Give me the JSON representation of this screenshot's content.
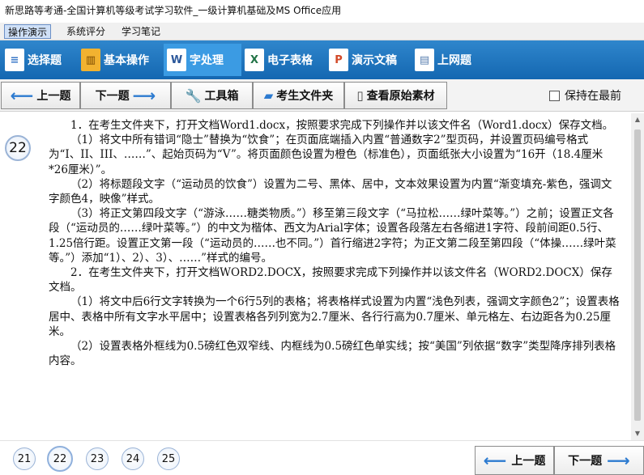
{
  "window": {
    "title": "新思路等考通-全国计算机等级考试学习软件_一级计算机基础及MS Office应用"
  },
  "menu": {
    "items": [
      "操作演示",
      "系统评分",
      "学习笔记"
    ]
  },
  "categories": [
    {
      "label": "选择题",
      "icon": "list-icon",
      "color": "#3a78c8"
    },
    {
      "label": "基本操作",
      "icon": "books-icon",
      "color": "#e0a020"
    },
    {
      "label": "字处理",
      "icon": "word-icon",
      "color": "#2b579a"
    },
    {
      "label": "电子表格",
      "icon": "excel-icon",
      "color": "#217346"
    },
    {
      "label": "演示文稿",
      "icon": "powerpoint-icon",
      "color": "#d24726"
    },
    {
      "label": "上网题",
      "icon": "document-icon",
      "color": "#5a7fb0"
    }
  ],
  "toolbar": {
    "prev": "上一题",
    "next": "下一题",
    "tools": "工具箱",
    "folder": "考生文件夹",
    "view": "查看原始素材",
    "keep_front": "保持在最前"
  },
  "question": {
    "number": "22",
    "paragraphs": [
      "1．在考生文件夹下，打开文档Word1.docx，按照要求完成下列操作并以该文件名（Word1.docx）保存文档。",
      "（1）将文中所有错词“隐士”替换为“饮食”；在页面底端插入内置“普通数字2”型页码，并设置页码编号格式为“I、II、III、……”、起始页码为“V”。将页面颜色设置为橙色（标准色），页面纸张大小设置为“16开（18.4厘米*26厘米）”。",
      "（2）将标题段文字（“运动员的饮食”）设置为二号、黑体、居中，文本效果设置为内置“渐变填充-紫色，强调文字颜色4，映像”样式。",
      "（3）将正文第四段文字（“游泳……糖类物质。”）移至第三段文字（“马拉松……绿叶菜等。”）之前；设置正文各段（“运动员的……绿叶菜等。”）的中文为楷体、西文为Arial字体；设置各段落左右各缩进1字符、段前间距0.5行、1.25倍行距。设置正文第一段（“运动员的……也不同。”）首行缩进2字符；为正文第二段至第四段（“体操……绿叶菜等。”）添加“1）、2）、3）、……”样式的编号。",
      "2．在考生文件夹下，打开文档WORD2.DOCX，按照要求完成下列操作并以该文件名（WORD2.DOCX）保存文档。",
      "（1）将文中后6行文字转换为一个6行5列的表格；将表格样式设置为内置“浅色列表，强调文字颜色2”；设置表格居中、表格中所有文字水平居中；设置表格各列列宽为2.7厘米、各行行高为0.7厘米、单元格左、右边距各为0.25厘米。",
      "（2）设置表格外框线为0.5磅红色双窄线、内框线为0.5磅红色单实线；按“美国”列依据“数字”类型降序排列表格内容。"
    ]
  },
  "pager": {
    "pages": [
      "21",
      "22",
      "23",
      "24",
      "25"
    ],
    "current": "22",
    "prev": "上一题",
    "next": "下一题"
  }
}
